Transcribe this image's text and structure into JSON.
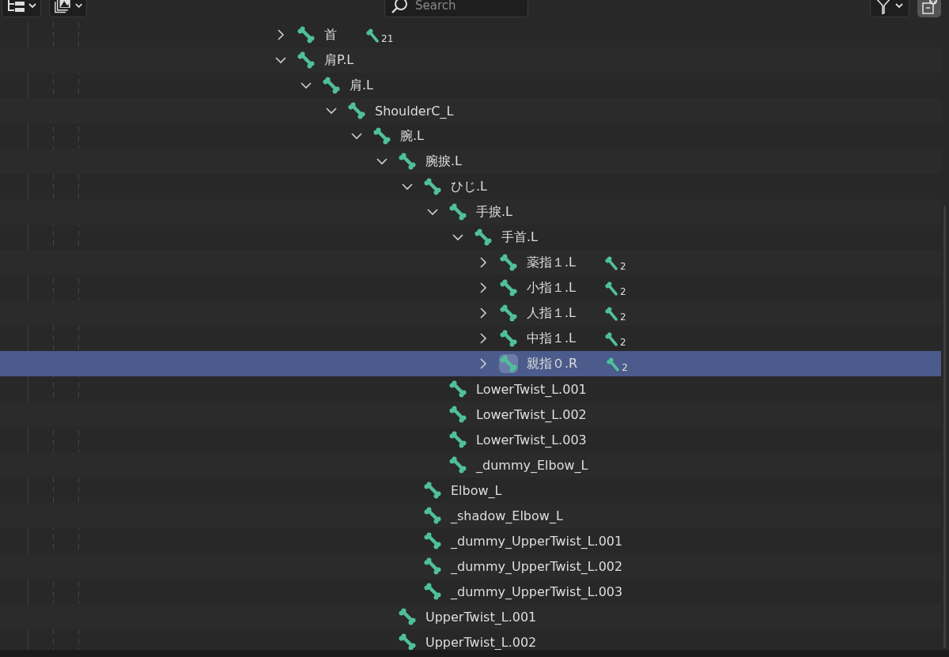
{
  "header": {
    "search": {
      "placeholder": "Search"
    }
  },
  "tree": [
    {
      "label": "首",
      "kind": "parent",
      "expanded": false,
      "selected": false,
      "badge": "21"
    },
    {
      "label": "肩P.L",
      "kind": "parent",
      "expanded": true,
      "selected": false,
      "children": [
        {
          "label": "肩.L",
          "kind": "parent",
          "expanded": true,
          "selected": false,
          "children": [
            {
              "label": "ShoulderC_L",
              "kind": "parent",
              "expanded": true,
              "selected": false,
              "children": [
                {
                  "label": "腕.L",
                  "kind": "parent",
                  "expanded": true,
                  "selected": false,
                  "children": [
                    {
                      "label": "腕捩.L",
                      "kind": "parent",
                      "expanded": true,
                      "selected": false,
                      "children": [
                        {
                          "label": "ひじ.L",
                          "kind": "parent",
                          "expanded": true,
                          "selected": false,
                          "children": [
                            {
                              "label": "手捩.L",
                              "kind": "parent",
                              "expanded": true,
                              "selected": false,
                              "children": [
                                {
                                  "label": "手首.L",
                                  "kind": "parent",
                                  "expanded": true,
                                  "selected": false,
                                  "children": [
                                    {
                                      "label": "薬指１.L",
                                      "kind": "parent",
                                      "expanded": false,
                                      "selected": false,
                                      "badge": "2"
                                    },
                                    {
                                      "label": "小指１.L",
                                      "kind": "parent",
                                      "expanded": false,
                                      "selected": false,
                                      "badge": "2"
                                    },
                                    {
                                      "label": "人指１.L",
                                      "kind": "parent",
                                      "expanded": false,
                                      "selected": false,
                                      "badge": "2"
                                    },
                                    {
                                      "label": "中指１.L",
                                      "kind": "parent",
                                      "expanded": false,
                                      "selected": false,
                                      "badge": "2"
                                    },
                                    {
                                      "label": "親指０.R",
                                      "kind": "parent",
                                      "expanded": false,
                                      "selected": true,
                                      "badge": "2"
                                    }
                                  ]
                                },
                                {
                                  "label": "LowerTwist_L.001",
                                  "kind": "leaf",
                                  "selected": false
                                },
                                {
                                  "label": "LowerTwist_L.002",
                                  "kind": "leaf",
                                  "selected": false
                                },
                                {
                                  "label": "LowerTwist_L.003",
                                  "kind": "leaf",
                                  "selected": false
                                },
                                {
                                  "label": "_dummy_Elbow_L",
                                  "kind": "leaf",
                                  "selected": false
                                }
                              ]
                            },
                            {
                              "label": "Elbow_L",
                              "kind": "leaf",
                              "selected": false
                            },
                            {
                              "label": "_shadow_Elbow_L",
                              "kind": "leaf",
                              "selected": false
                            },
                            {
                              "label": "_dummy_UpperTwist_L.001",
                              "kind": "leaf",
                              "selected": false
                            },
                            {
                              "label": "_dummy_UpperTwist_L.002",
                              "kind": "leaf",
                              "selected": false
                            },
                            {
                              "label": "_dummy_UpperTwist_L.003",
                              "kind": "leaf",
                              "selected": false
                            }
                          ]
                        },
                        {
                          "label": "UpperTwist_L.001",
                          "kind": "leaf",
                          "selected": false
                        },
                        {
                          "label": "UpperTwist_L.002",
                          "kind": "leaf",
                          "selected": false
                        }
                      ]
                    }
                  ]
                }
              ]
            }
          ]
        }
      ]
    }
  ]
}
